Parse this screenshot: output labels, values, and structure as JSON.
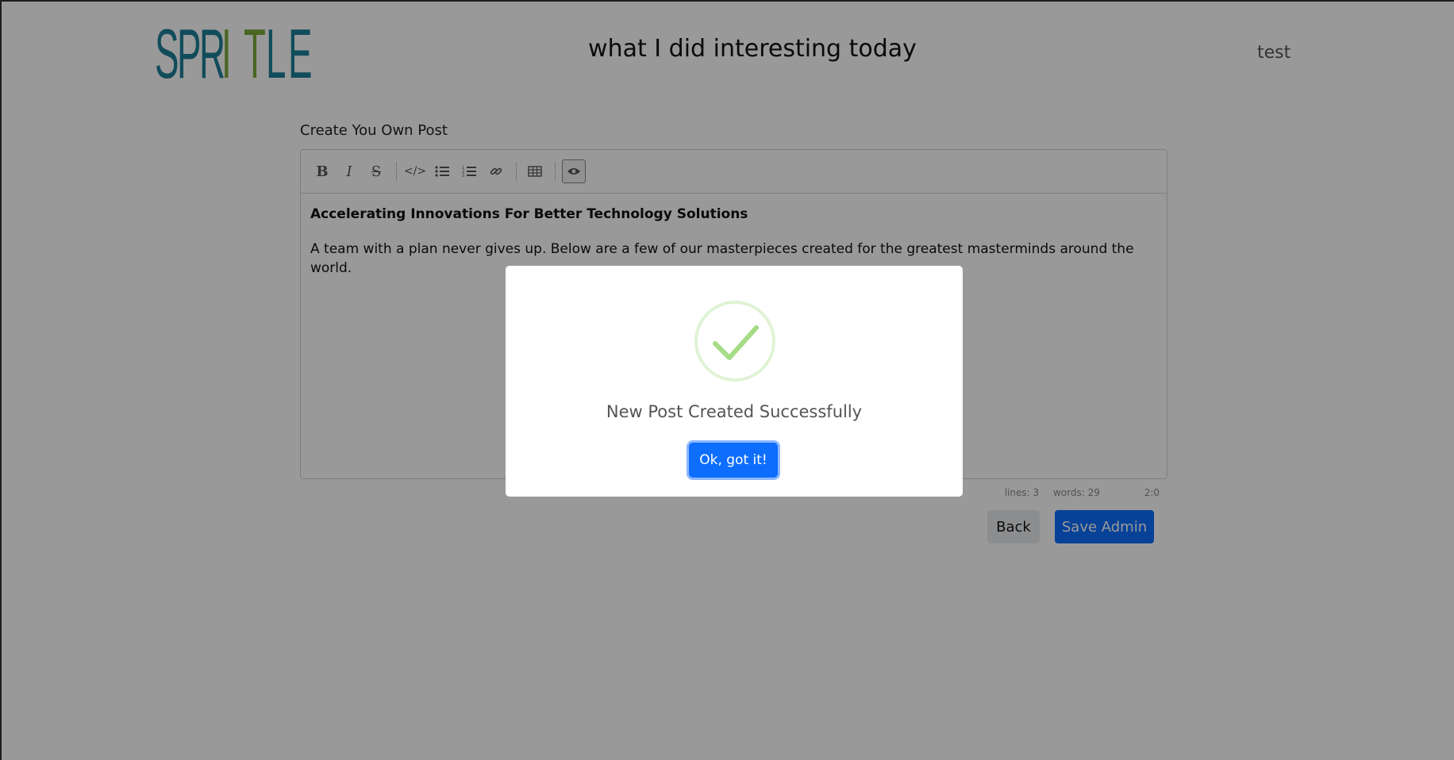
{
  "header": {
    "logo_letters": [
      "S",
      "P",
      "R",
      "I",
      "T",
      "L",
      "E"
    ],
    "logo_colors": {
      "primary": "#1d7f98",
      "accent": "#7cab3a"
    },
    "title": "what I did interesting today",
    "user": "test"
  },
  "editor": {
    "label": "Create You Own Post",
    "toolbar": [
      {
        "name": "bold",
        "glyph": "B"
      },
      {
        "name": "italic",
        "glyph": "I"
      },
      {
        "name": "strikethrough",
        "glyph": "S"
      },
      {
        "name": "code",
        "glyph": "</>"
      },
      {
        "name": "bullet-list",
        "glyph": "list"
      },
      {
        "name": "numbered-list",
        "glyph": "olist"
      },
      {
        "name": "link",
        "glyph": "link"
      },
      {
        "name": "table",
        "glyph": "table"
      },
      {
        "name": "preview",
        "glyph": "eye"
      }
    ],
    "heading": "Accelerating Innovations For Better Technology Solutions",
    "body": "A team with a plan never gives up. Below are a few of our masterpieces created for the greatest masterminds around the world."
  },
  "status": {
    "lines": "lines: 3",
    "words": "words: 29",
    "cursor": "2:0"
  },
  "actions": {
    "back_label": "Back",
    "save_label": "Save Admin"
  },
  "modal": {
    "message": "New Post Created Successfully",
    "confirm_label": "Ok, got it!",
    "icon": "success-check-icon",
    "icon_color": "#a5dc86"
  }
}
